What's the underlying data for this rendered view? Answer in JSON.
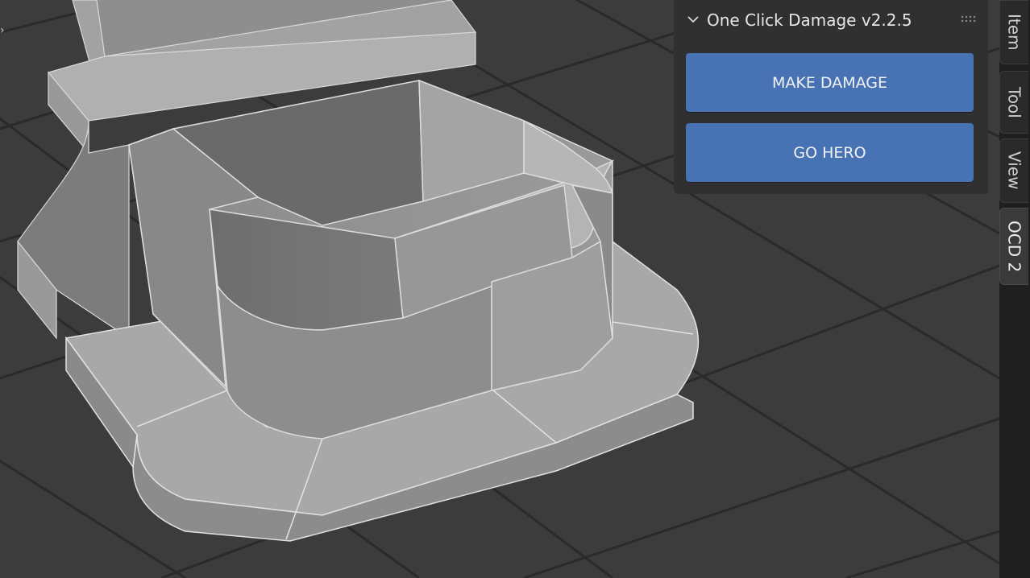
{
  "panel": {
    "title": "One Click Damage v2.2.5",
    "buttons": {
      "make_damage": "MAKE DAMAGE",
      "go_hero": "GO HERO"
    }
  },
  "tabs": [
    {
      "label": "Item",
      "active": false
    },
    {
      "label": "Tool",
      "active": false
    },
    {
      "label": "View",
      "active": false
    },
    {
      "label": "OCD 2",
      "active": true
    }
  ],
  "icons": {
    "collapse": "chevron-down-icon",
    "drag": "drag-handle-icon",
    "expand": "chevron-right-icon"
  },
  "colors": {
    "button": "#4772b3",
    "panel": "#303030",
    "viewport": "#3c3c3c",
    "grid": "#2a2a2a"
  }
}
